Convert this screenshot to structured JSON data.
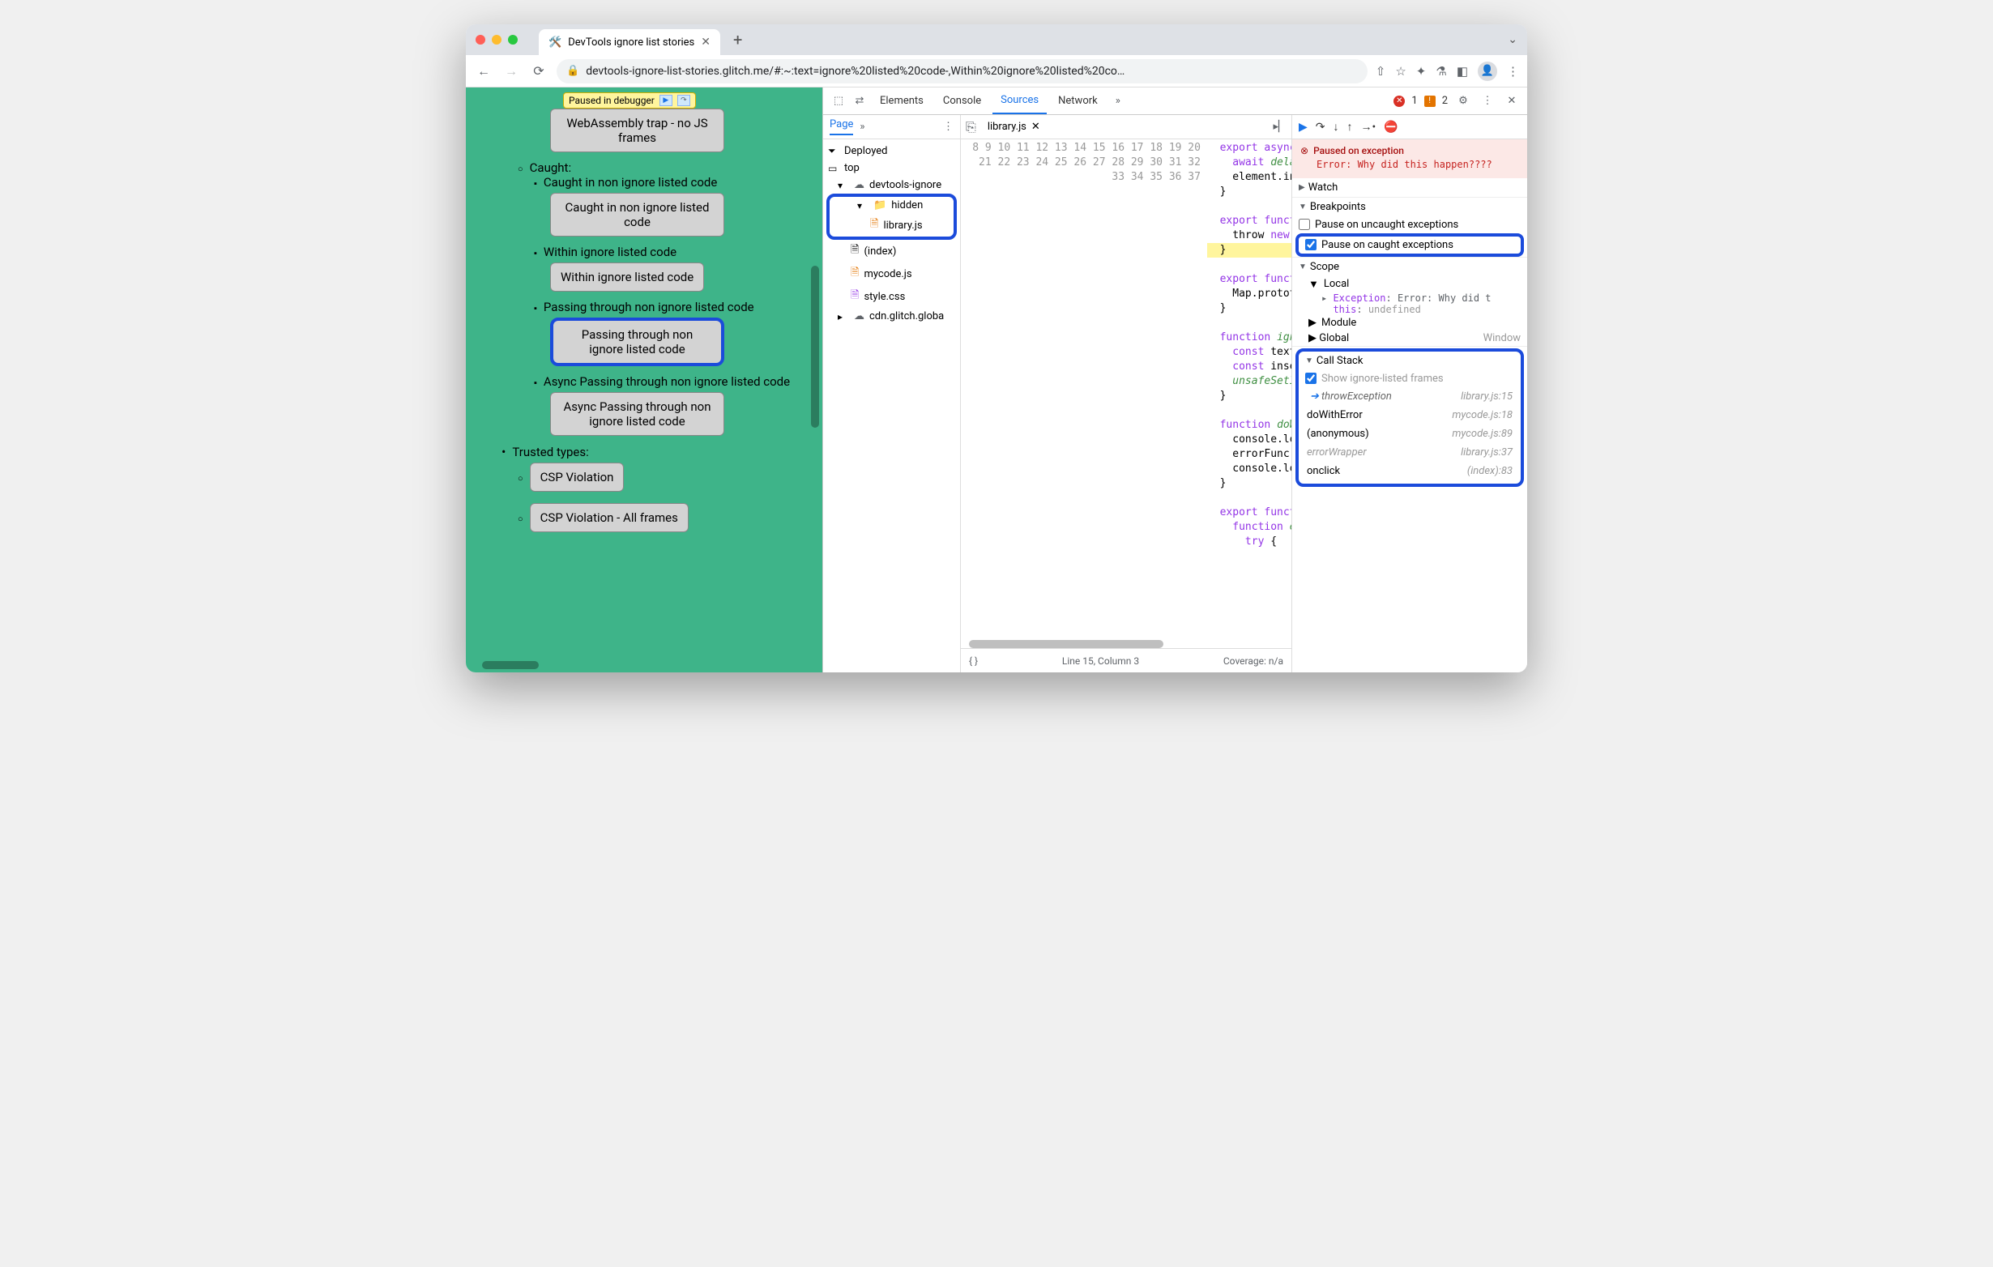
{
  "browser": {
    "tab_title": "DevTools ignore list stories",
    "url": "devtools-ignore-list-stories.glitch.me/#:~:text=ignore%20listed%20code-,Within%20ignore%20listed%20co…"
  },
  "page": {
    "paused_pill": "Paused in debugger",
    "items": {
      "wasm_btn": "WebAssembly trap - no JS frames",
      "caught_hdr": "Caught:",
      "caught_non_ignore_li": "Caught in non ignore listed code",
      "caught_non_ignore_btn": "Caught in non ignore listed code",
      "within_ignore_li": "Within ignore listed code",
      "within_ignore_btn": "Within ignore listed code",
      "passing_li": "Passing through non ignore listed code",
      "passing_btn": "Passing through non ignore listed code",
      "async_li": "Async Passing through non ignore listed code",
      "async_btn": "Async Passing through non ignore listed code",
      "trusted_hdr": "Trusted types:",
      "csp_btn": "CSP Violation",
      "csp_all_btn": "CSP Violation - All frames"
    }
  },
  "devtools": {
    "tabs": {
      "elements": "Elements",
      "console": "Console",
      "sources": "Sources",
      "network": "Network"
    },
    "errors": "1",
    "warnings": "2",
    "sources": {
      "page_tab": "Page",
      "tree": {
        "deployed": "Deployed",
        "top": "top",
        "domain": "devtools-ignore",
        "hidden": "hidden",
        "library": "library.js",
        "index": "(index)",
        "mycode": "mycode.js",
        "style": "style.css",
        "cdn": "cdn.glitch.globa"
      },
      "open_file": "library.js",
      "gutter_start": 8,
      "gutter_end": 37,
      "code_lines": [
        "export async function unsafeS",
        "  await delay();",
        "  element.innerHTML = text;",
        "}",
        "",
        "export function throwExceptio",
        "  throw new Error('Why did th",
        "}",
        "",
        "export function errorFromRunt",
        "  Map.prototype.set();",
        "}",
        "",
        "function ignoredcspviolation(",
        "  const text = document.getE",
        "  const insertionPoint = docu",
        "  unsafeSetInnerHtml(insertio",
        "}",
        "",
        "function doWithError(errorFun",
        "  console.log('No error yet')",
        "  errorFunc();",
        "  console.log('Never happened",
        "}",
        "",
        "export function wrapErrorHand",
        "  function errorWrapper() {",
        "    try {",
        "",
        ""
      ],
      "status_line": "Line 15, Column 3",
      "status_coverage": "Coverage: n/a"
    },
    "debugger": {
      "paused_title": "Paused on exception",
      "paused_err": "Error: Why did this happen????",
      "sections": {
        "watch": "Watch",
        "breakpoints": "Breakpoints",
        "uncaught": "Pause on uncaught exceptions",
        "caught": "Pause on caught exceptions",
        "scope": "Scope",
        "local": "Local",
        "exception_k": "Exception",
        "exception_v": "Error: Why did t",
        "this_k": "this",
        "this_v": "undefined",
        "module": "Module",
        "global": "Global",
        "global_v": "Window",
        "callstack": "Call Stack",
        "show_ignored": "Show ignore-listed frames"
      },
      "frames": [
        {
          "name": "throwException",
          "loc": "library.js:15",
          "ignored": true,
          "current": true
        },
        {
          "name": "doWithError",
          "loc": "mycode.js:18",
          "ignored": false
        },
        {
          "name": "(anonymous)",
          "loc": "mycode.js:89",
          "ignored": false
        },
        {
          "name": "errorWrapper",
          "loc": "library.js:37",
          "ignored": true
        },
        {
          "name": "onclick",
          "loc": "(index):83",
          "ignored": false
        }
      ]
    }
  }
}
